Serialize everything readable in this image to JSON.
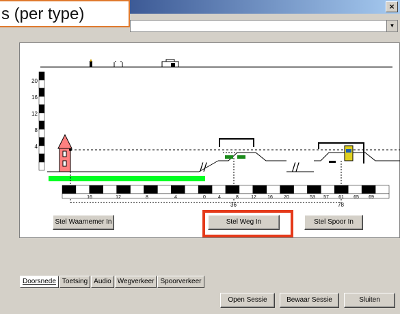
{
  "window": {
    "close_glyph": "×"
  },
  "callout": {
    "text": "s (per type)"
  },
  "combo": {
    "value": "",
    "arrow": "▼"
  },
  "scene": {
    "y_axis_ticks": [
      "20",
      "16",
      "12",
      "8",
      "4"
    ],
    "ruler_labels": [
      "16",
      "12",
      "8",
      "4",
      "0",
      "4",
      "8",
      "12",
      "16",
      "20",
      "53",
      "57",
      "61",
      "65",
      "69"
    ],
    "sub_labels": [
      "36",
      "78"
    ],
    "colors": {
      "green": "#00ff22",
      "red_pole": "#ff0000",
      "highlight": "#e53a1a"
    }
  },
  "buttons": {
    "observer": "Stel Waarnemer In",
    "road": "Stel Weg In",
    "rail": "Stel Spoor In"
  },
  "tabs": [
    "Doorsnede",
    "Toetsing",
    "Audio",
    "Wegverkeer",
    "Spoorverkeer"
  ],
  "footer": {
    "open": "Open Sessie",
    "save": "Bewaar Sessie",
    "close": "Sluiten"
  }
}
